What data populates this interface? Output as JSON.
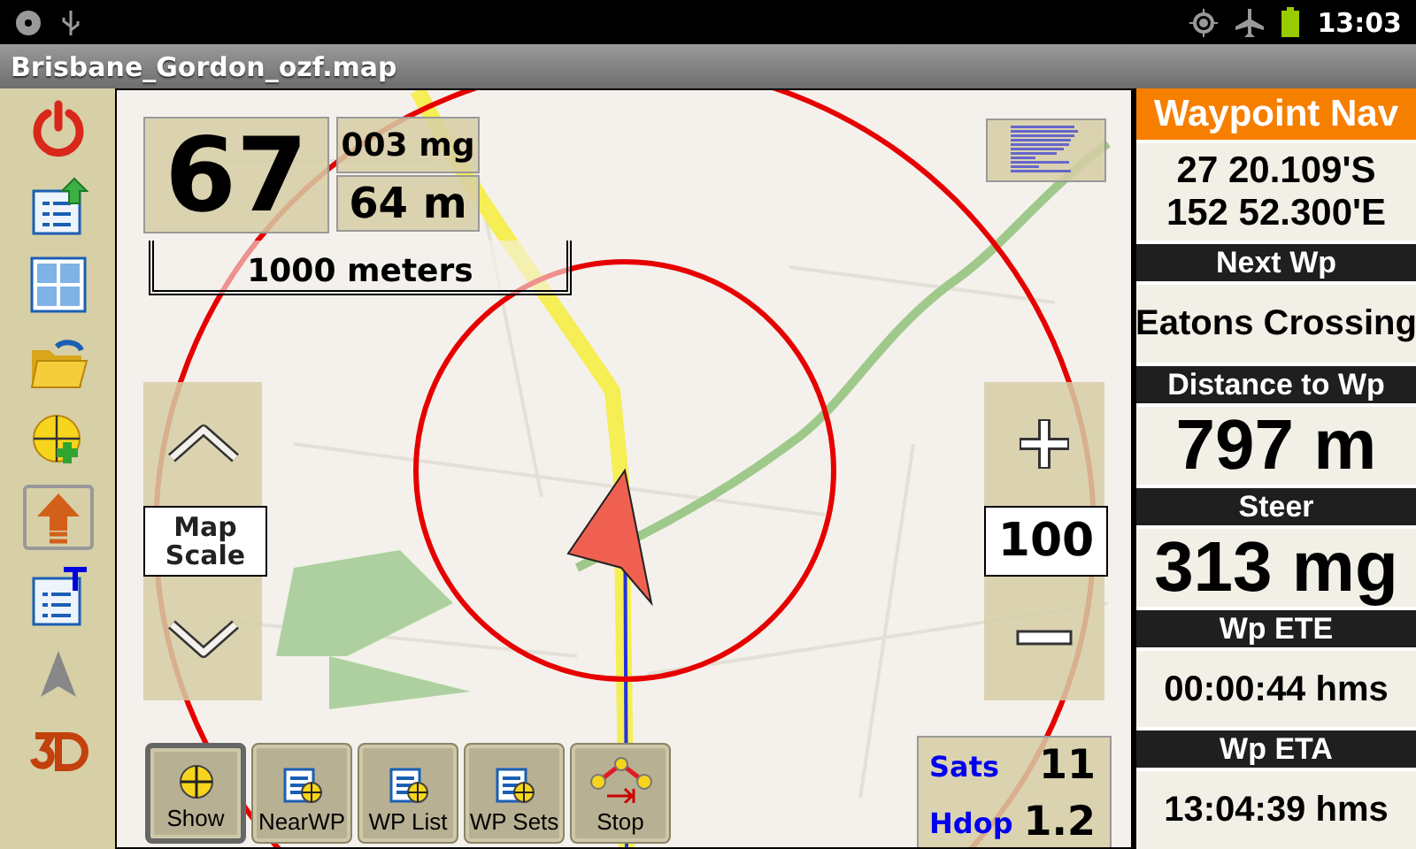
{
  "status_bar": {
    "time": "13:03"
  },
  "window": {
    "title": "Brisbane_Gordon_ozf.map"
  },
  "toolbar": [
    {
      "kind": "power",
      "selected": false
    },
    {
      "kind": "list-up",
      "selected": false
    },
    {
      "kind": "grid",
      "selected": false
    },
    {
      "kind": "folder",
      "selected": false
    },
    {
      "kind": "add-waypoint",
      "selected": false
    },
    {
      "kind": "up-arrow",
      "selected": true
    },
    {
      "kind": "list-text",
      "selected": false
    },
    {
      "kind": "pointer",
      "selected": false
    },
    {
      "kind": "threed",
      "selected": false
    }
  ],
  "map": {
    "speed": "67",
    "heading": "003 mg",
    "altitude": "64 m",
    "scale": "1000 meters",
    "zoom": {
      "label": "Map Scale",
      "value": "100"
    },
    "gps": {
      "sats_label": "Sats",
      "sats": "11",
      "hdop_label": "Hdop",
      "hdop": "1.2"
    },
    "buttons": [
      {
        "kind": "show",
        "label": "Show",
        "selected": true
      },
      {
        "kind": "near",
        "label": "NearWP",
        "selected": false
      },
      {
        "kind": "list",
        "label": "WP List",
        "selected": false
      },
      {
        "kind": "sets",
        "label": "WP Sets",
        "selected": false
      },
      {
        "kind": "route",
        "label": "Stop",
        "selected": false
      }
    ]
  },
  "panel": {
    "title": "Waypoint Nav",
    "position": [
      "27 20.109'S",
      "152 52.300'E"
    ],
    "sections": [
      {
        "heading": "Next Wp",
        "value": "Eatons Crossing",
        "kind": "normal"
      },
      {
        "heading": "Distance to Wp",
        "value": "797 m",
        "kind": "big"
      },
      {
        "heading": "Steer",
        "value": "313 mg",
        "kind": "big"
      },
      {
        "heading": "Wp ETE",
        "value": "00:00:44 hms",
        "kind": "normal"
      },
      {
        "heading": "Wp ETA",
        "value": "13:04:39 hms",
        "kind": "normal"
      }
    ]
  }
}
